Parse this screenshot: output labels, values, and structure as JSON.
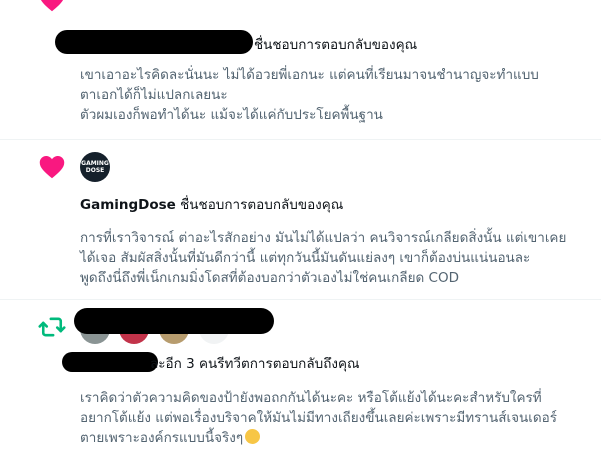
{
  "notifications": [
    {
      "type": "like",
      "headline_suffix": "ชื่นชอบการตอบกลับของคุณ",
      "reply_lines": [
        "เขาเอาอะไรคิดละนั่นนะ ไม่ได้อวยพี่เอกนะ แต่คนที่เรียนมาจนชำนาญจะทำแบบ",
        "ตาเอกได้ก็ไม่แปลกเลยนะ",
        "ตัวผมเองก็พอทำได้นะ แม้จะได้แค่กับประโยคพื้นฐาน"
      ],
      "icon_color": "#f91880"
    },
    {
      "type": "like",
      "user": "GamingDose",
      "avatar_text": "GAMING DOSE",
      "headline_suffix": "ชื่นชอบการตอบกลับของคุณ",
      "reply_lines": [
        "การที่เราวิจารณ์ ต่าอะไรสักอย่าง มันไม่ได้แปลว่า คนวิจารณ์เกลียดสิ่งนั้น แต่เขาเคย",
        "ได้เจอ สัมผัสสิ่งนั้นที่มันดีกว่านี้ แต่ทุกวันนี้มันดันแย่ลงๆ เขาก็ต้องบ่นแน่นอนละ",
        "พูดถึงนี่ถึงพี่เน็กเกมมิ่งโดสที่ต้องบอกว่าตัวเองไม่ใช่คนเกลียด COD"
      ],
      "icon_color": "#f91880"
    },
    {
      "type": "repost",
      "headline_suffix": "ละอีก 3 คนรีทวีตการตอบกลับถึงคุณ",
      "reply_lines": [
        "เราคิดว่าตัวความคิดของป้ายังพอถกกันได้นะคะ หรือโต้แย้งได้นะคะสำหรับใครที่",
        "อยากโต้แย้ง แต่พอเรื่องบริจาคให้มันไม่มีทางเถียงขึ้นเลยค่ะเพราะมีทรานส์เจนเดอร์",
        "ตายเพราะองค์กรแบบนี้จริงๆ"
      ],
      "icon_color": "#00ba7c"
    }
  ]
}
